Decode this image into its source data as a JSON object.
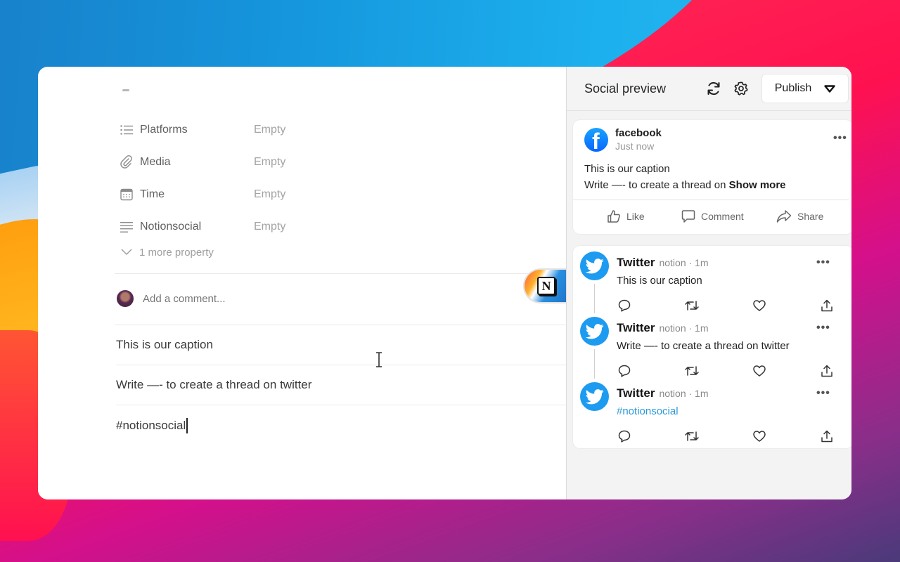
{
  "editor": {
    "properties": [
      {
        "name": "Platforms",
        "value": "Empty",
        "icon": "list-icon"
      },
      {
        "name": "Media",
        "value": "Empty",
        "icon": "paperclip-icon"
      },
      {
        "name": "Time",
        "value": "Empty",
        "icon": "calendar-icon"
      },
      {
        "name": "Notionsocial",
        "value": "Empty",
        "icon": "text-lines-icon"
      }
    ],
    "more_property": "1 more property",
    "comment_placeholder": "Add a comment...",
    "blocks": [
      "This is our caption",
      "Write —- to create a thread on twitter",
      "#notionsocial"
    ]
  },
  "side_panel": {
    "title": "Social preview",
    "refresh_icon": "refresh-icon",
    "settings_icon": "gear-icon",
    "publish_label": "Publish",
    "facebook": {
      "name": "facebook",
      "time": "Just now",
      "line1": "This is our caption",
      "line2": "Write —- to create a thread on ",
      "show_more": "Show more",
      "actions": {
        "like": "Like",
        "comment": "Comment",
        "share": "Share"
      }
    },
    "twitter": [
      {
        "name": "Twitter",
        "handle": "notion · 1m",
        "text": "This is our caption"
      },
      {
        "name": "Twitter",
        "handle": "notion · 1m",
        "text": "Write —- to create a thread on twitter"
      },
      {
        "name": "Twitter",
        "handle": "notion · 1m",
        "text": "#notionsocial"
      }
    ]
  },
  "colors": {
    "twitter_blue": "#1d9bf0",
    "facebook_blue": "#0866ff",
    "hashtag_blue": "#2a9ad8"
  }
}
